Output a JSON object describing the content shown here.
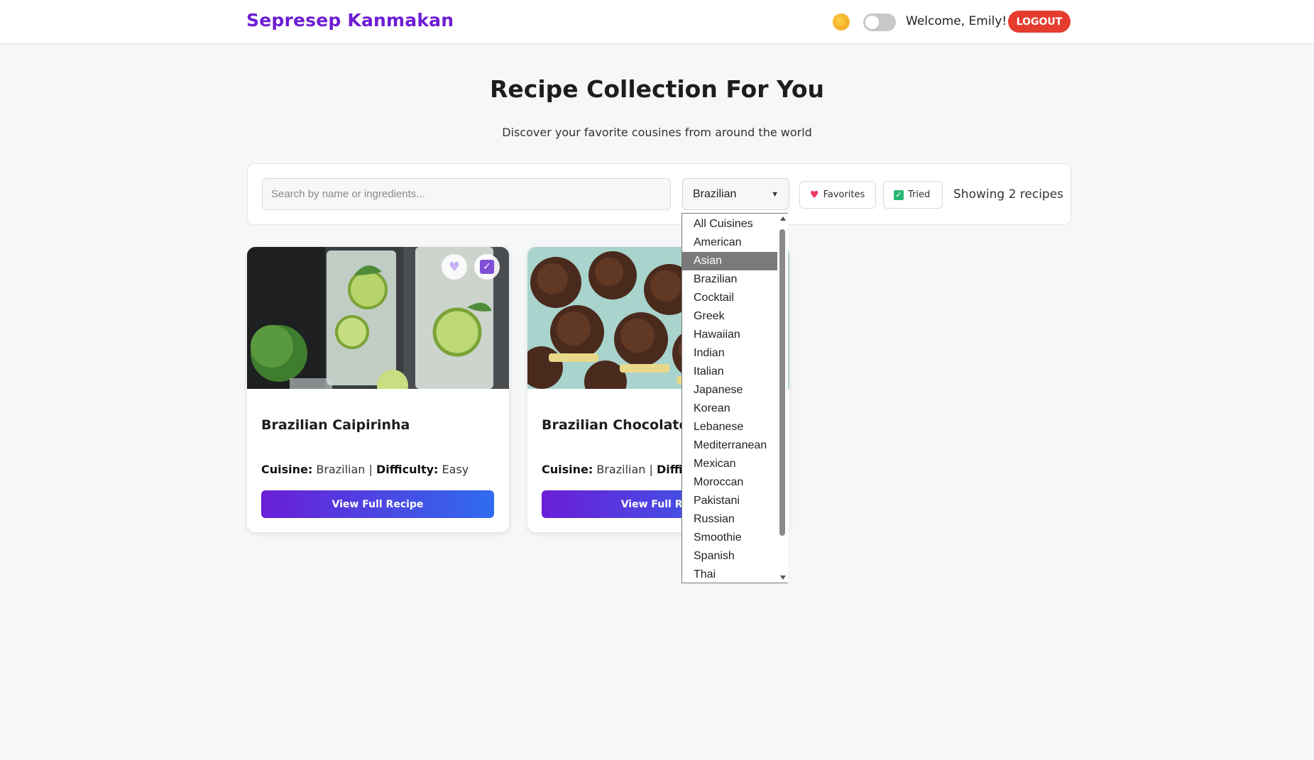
{
  "header": {
    "brand": "Sepresep Kanmakan",
    "welcome": "Welcome, Emily!",
    "logout_label": "LOGOUT",
    "theme_icon": "sun-icon"
  },
  "hero": {
    "title": "Recipe Collection For You",
    "subtitle": "Discover your favorite cousines from around the world"
  },
  "filters": {
    "search_placeholder": "Search by name or ingredients...",
    "search_value": "",
    "cuisine_selected": "Brazilian",
    "favorites_label": "Favorites",
    "tried_label": "Tried",
    "count_text": "Showing 2 recipes"
  },
  "dropdown": {
    "highlighted": "Asian",
    "options": [
      "All Cuisines",
      "American",
      "Asian",
      "Brazilian",
      "Cocktail",
      "Greek",
      "Hawaiian",
      "Indian",
      "Italian",
      "Japanese",
      "Korean",
      "Lebanese",
      "Mediterranean",
      "Mexican",
      "Moroccan",
      "Pakistani",
      "Russian",
      "Smoothie",
      "Spanish",
      "Thai"
    ]
  },
  "recipes": [
    {
      "title": "Brazilian Caipirinha",
      "cuisine_label": "Cuisine:",
      "cuisine": "Brazilian",
      "separator": "|",
      "difficulty_label": "Difficulty:",
      "difficulty": "Easy",
      "button_label": "View Full Recipe"
    },
    {
      "title": "Brazilian Chocolate E",
      "cuisine_label": "Cuisine:",
      "cuisine": "Brazilian",
      "separator": "|",
      "difficulty_label": "Diffic",
      "button_label": "View Full Rec"
    }
  ],
  "colors": {
    "brand": "#6d1ed4",
    "logout": "#e63c2f",
    "button_gradient_start": "#6a1ed5",
    "button_gradient_end": "#2f6cf0"
  }
}
